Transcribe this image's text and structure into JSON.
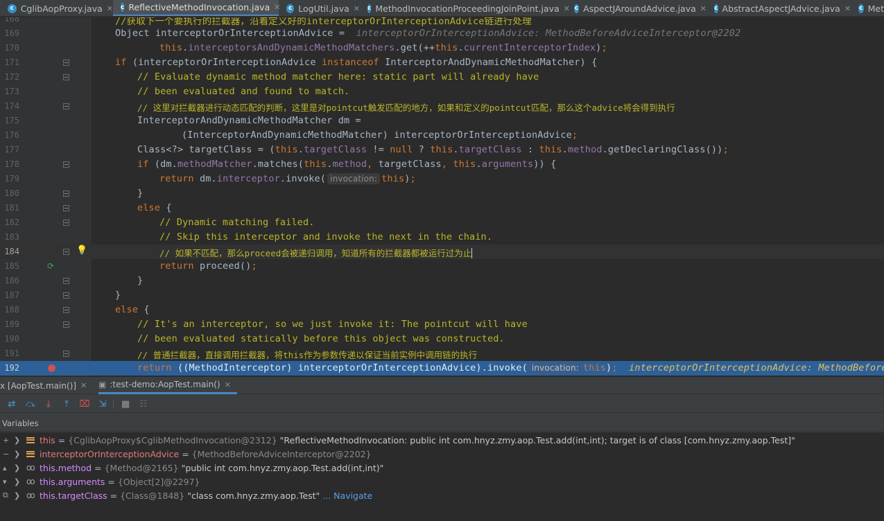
{
  "tabs": [
    {
      "label": "CglibAopProxy.java",
      "active": false
    },
    {
      "label": "ReflectiveMethodInvocation.java",
      "active": true
    },
    {
      "label": "LogUtil.java",
      "active": false
    },
    {
      "label": "MethodInvocationProceedingJoinPoint.java",
      "active": false
    },
    {
      "label": "AspectJAroundAdvice.java",
      "active": false
    },
    {
      "label": "AbstractAspectJAdvice.java",
      "active": false
    },
    {
      "label": "Met",
      "active": false
    }
  ],
  "editor": {
    "line_numbers": [
      "168",
      "169",
      "170",
      "171",
      "172",
      "173",
      "174",
      "175",
      "176",
      "177",
      "178",
      "179",
      "180",
      "181",
      "182",
      "183",
      "184",
      "185",
      "186",
      "187",
      "188",
      "189",
      "190",
      "191",
      "192"
    ],
    "top_comment": "//获取下一个要执行的拦截器，沿着定义好的interceptorOrInterceptionAdvice链进行处理",
    "hint_169": "interceptorOrInterceptionAdvice: MethodBeforeAdviceInterceptor@2202",
    "c172": "// Evaluate dynamic method matcher here: static part will already have",
    "c173": "// been evaluated and found to match.",
    "c174": "// 这里对拦截器进行动态匹配的判断，这里是对pointcut触发匹配的地方，如果和定义的pointcut匹配，那么这个advice将会得到执行",
    "c182": "// Dynamic matching failed.",
    "c183": "// Skip this interceptor and invoke the next in the chain.",
    "c184": "// 如果不匹配，那么proceed会被递归调用，知道所有的拦截器都被运行过为止",
    "c189": "// It's an interceptor, so we just invoke it: The pointcut will have",
    "c190": "// been evaluated statically before this object was constructed.",
    "c191": "// 普通拦截器，直接调用拦截器，将this作为参数传递以保证当前实例中调用链的执行",
    "param_hint": "invocation:",
    "hint_192": "interceptorOrInterceptionAdvice: MethodBeforeAdvi"
  },
  "debug": {
    "sessions": [
      {
        "label": "x [AopTest.main()]"
      },
      {
        "label": ":test-demo:AopTest.main()"
      }
    ],
    "variables_label": "Variables",
    "variables": [
      {
        "name": "this",
        "eq": " = ",
        "type": "{CglibAopProxy$CglibMethodInvocation@2312}",
        "value": " \"ReflectiveMethodInvocation: public int com.hnyz.zmy.aop.Test.add(int,int); target is of class [com.hnyz.zmy.aop.Test]\"",
        "link": ""
      },
      {
        "name": "interceptorOrInterceptionAdvice",
        "eq": " = ",
        "type": "{MethodBeforeAdviceInterceptor@2202}",
        "value": "",
        "link": ""
      },
      {
        "name": "this.method",
        "eq": " = ",
        "type": "{Method@2165}",
        "value": " \"public int com.hnyz.zmy.aop.Test.add(int,int)\"",
        "link": ""
      },
      {
        "name": "this.arguments",
        "eq": " = ",
        "type": "{Object[2]@2297}",
        "value": "",
        "link": ""
      },
      {
        "name": "this.targetClass",
        "eq": " = ",
        "type": "{Class@1848}",
        "value": " \"class com.hnyz.zmy.aop.Test\"",
        "link": " ... Navigate"
      }
    ]
  }
}
